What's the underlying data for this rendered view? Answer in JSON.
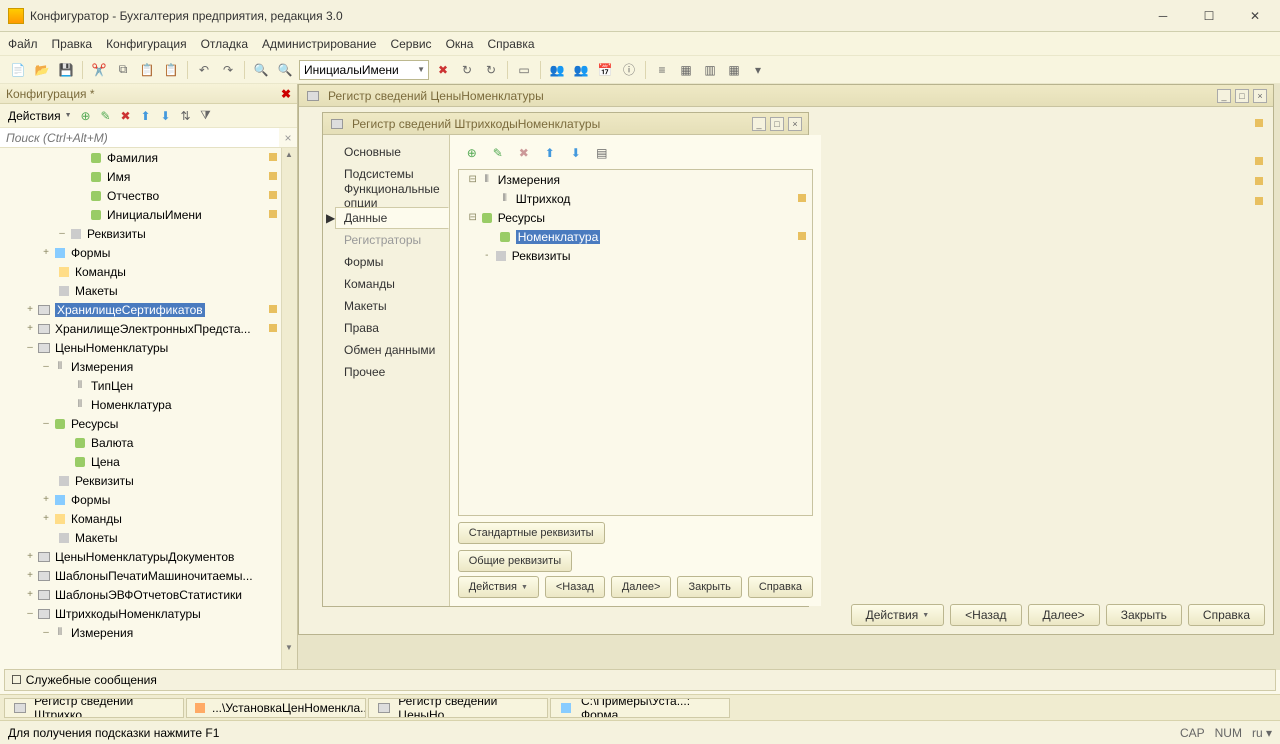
{
  "window": {
    "title": "Конфигуратор - Бухгалтерия предприятия, редакция 3.0"
  },
  "menu": {
    "file": "Файл",
    "edit": "Правка",
    "config": "Конфигурация",
    "debug": "Отладка",
    "admin": "Администрирование",
    "service": "Сервис",
    "windows": "Окна",
    "help": "Справка"
  },
  "toolbar": {
    "combo": "ИнициалыИмени"
  },
  "left": {
    "header": "Конфигурация *",
    "actions": "Действия",
    "search_placeholder": "Поиск (Ctrl+Alt+M)",
    "items": {
      "familiya": "Фамилия",
      "imya": "Имя",
      "otchestvo": "Отчество",
      "iniciali": "ИнициалыИмени",
      "rekvizity": "Реквизиты",
      "formy": "Формы",
      "komandy": "Команды",
      "makety": "Макеты",
      "hranilishe_sert": "ХранилищеСертификатов",
      "hranilishe_elek": "ХранилищеЭлектронныхПредста...",
      "ceny": "ЦеныНоменклатуры",
      "izmereniya": "Измерения",
      "tipcen": "ТипЦен",
      "nomenklatura": "Номенклатура",
      "resursy": "Ресурсы",
      "valuta": "Валюта",
      "cena": "Цена",
      "rekvizity2": "Реквизиты",
      "formy2": "Формы",
      "komandy2": "Команды",
      "makety2": "Макеты",
      "ceny_dok": "ЦеныНоменклатурыДокументов",
      "shablony_mash": "ШаблоныПечатиМашиночитаемы...",
      "shablony_evf": "ШаблоныЭВФОтчетовСтатистики",
      "shtrih": "ШтрихкодыНоменклатуры",
      "izmereniya2": "Измерения"
    }
  },
  "win1": {
    "title": "Регистр сведений ЦеныНоменклатуры"
  },
  "win2": {
    "title": "Регистр сведений ШтрихкодыНоменклатуры",
    "tabs": {
      "osnov": "Основные",
      "podsis": "Подсистемы",
      "funkc": "Функциональные опции",
      "dannye": "Данные",
      "registr": "Регистраторы",
      "formy": "Формы",
      "komandy": "Команды",
      "makety": "Макеты",
      "prava": "Права",
      "obmen": "Обмен данными",
      "prochee": "Прочее"
    },
    "tree": {
      "izm": "Измерения",
      "shtrih": "Штрихкод",
      "res": "Ресурсы",
      "nomen": "Номенклатура",
      "rekv": "Реквизиты"
    },
    "btns": {
      "std": "Стандартные реквизиты",
      "common": "Общие реквизиты",
      "actions": "Действия",
      "back": "<Назад",
      "next": "Далее>",
      "close": "Закрыть",
      "help": "Справка"
    }
  },
  "filetabs": {
    "t1": "Регистр сведений Штрихко...",
    "t2": "...\\УстановкаЦенНоменкла...",
    "t3": "Регистр сведений ЦеныНо...",
    "t4": "С:\\Примеры\\Уста...: Форма"
  },
  "svc": "Служебные сообщения",
  "status": {
    "hint": "Для получения подсказки нажмите F1",
    "cap": "CAP",
    "num": "NUM",
    "lang": "ru ▾"
  }
}
